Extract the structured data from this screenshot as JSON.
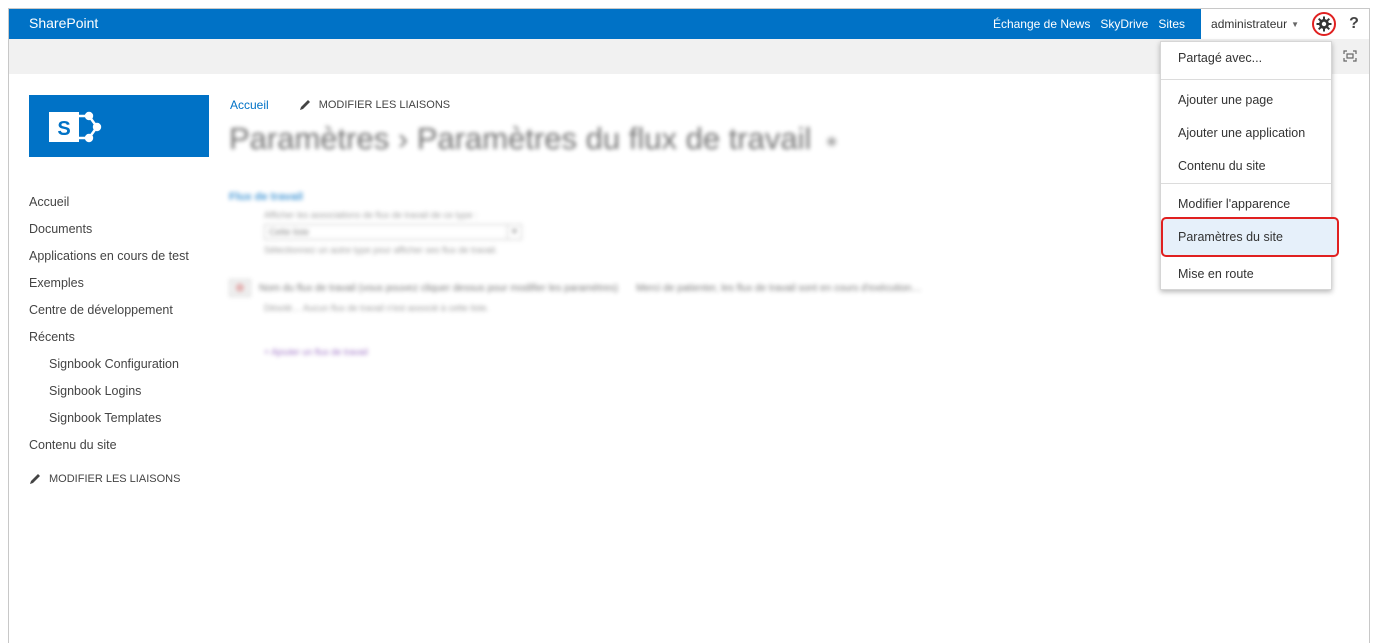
{
  "suite_bar": {
    "brand": "SharePoint",
    "links": [
      "Échange de News",
      "SkyDrive",
      "Sites"
    ],
    "user": "administrateur",
    "help": "?"
  },
  "logo": {
    "letter": "S"
  },
  "breadcrumb": {
    "home": "Accueil",
    "edit_links": "MODIFIER LES LIAISONS"
  },
  "page_title": {
    "main": "Paramètres",
    "sep": "›",
    "sub": "Paramètres du flux de travail",
    "info": "◉"
  },
  "nav": {
    "items": [
      {
        "label": "Accueil"
      },
      {
        "label": "Documents"
      },
      {
        "label": "Applications en cours de test"
      },
      {
        "label": "Exemples"
      },
      {
        "label": "Centre de développement"
      },
      {
        "label": "Récents"
      },
      {
        "label": "Signbook Configuration"
      },
      {
        "label": "Signbook Logins"
      },
      {
        "label": "Signbook Templates"
      },
      {
        "label": "Contenu du site"
      }
    ],
    "edit_links": "MODIFIER LES LIAISONS"
  },
  "content": {
    "section_title": "Flux de travail",
    "assoc_label": "Afficher les associations de flux de travail de ce type :",
    "select_value": "Cette liste",
    "assoc_hint": "Sélectionnez un autre type pour afficher ses flux de travail.",
    "workflow_header": "Nom du flux de travail (vous pouvez cliquer dessus pour modifier les paramètres)",
    "workflow_status": "Merci de patienter, les flux de travail sont en cours d'exécution…",
    "workflow_empty": "Désolé… Aucun flux de travail n'est associé à cette liste.",
    "add_workflow": "+ Ajouter un flux de travail"
  },
  "settings_menu": {
    "items": [
      {
        "label": "Partagé avec..."
      },
      {
        "label": "Ajouter une page"
      },
      {
        "label": "Ajouter une application"
      },
      {
        "label": "Contenu du site"
      },
      {
        "label": "Modifier l'apparence"
      },
      {
        "label": "Paramètres du site"
      },
      {
        "label": "Mise en route"
      }
    ],
    "highlighted": "Paramètres du site"
  },
  "colors": {
    "suite_bar": "#0072c6",
    "highlight_border": "#e02020",
    "link": "#0072c6"
  }
}
